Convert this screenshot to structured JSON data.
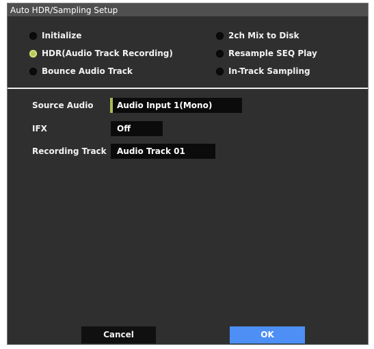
{
  "dialog": {
    "title": "Auto HDR/Sampling Setup"
  },
  "modes": {
    "left": [
      {
        "label": "Initialize",
        "selected": false
      },
      {
        "label": "HDR(Audio Track Recording)",
        "selected": true
      },
      {
        "label": "Bounce Audio Track",
        "selected": false
      }
    ],
    "right": [
      {
        "label": "2ch Mix to Disk",
        "selected": false
      },
      {
        "label": "Resample SEQ Play",
        "selected": false
      },
      {
        "label": "In-Track Sampling",
        "selected": false
      }
    ]
  },
  "params": {
    "source_audio": {
      "label": "Source Audio",
      "value": "Audio Input 1(Mono)"
    },
    "ifx": {
      "label": "IFX",
      "value": "Off"
    },
    "recording_track": {
      "label": "Recording Track",
      "value": "Audio Track 01"
    }
  },
  "buttons": {
    "cancel_label": "Cancel",
    "ok_label": "OK"
  },
  "colors": {
    "background": "#2f2f2f",
    "titlebar": "#4f4f4f",
    "selected_radio": "#b5c85a",
    "focus_accent": "#a9bb55",
    "ok_button": "#4d8ff5",
    "value_field": "#0b0b0b"
  }
}
